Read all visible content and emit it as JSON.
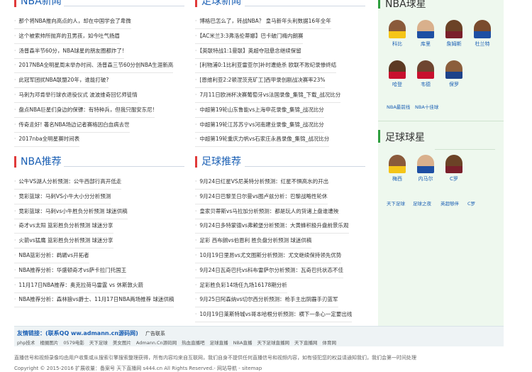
{
  "sections": {
    "nba_news": {
      "title": "NBA新闻",
      "items": [
        "那个将NBA推向高点的人，却在中国学会了卑微",
        "这个被索帅所抛弃的丑男孩，如今吐气扬眉",
        "汤普森半节60分，NBA球星的朋友圈都炸了!",
        "2017NBA全明星周末举办时间、汤普森三节60分创NBA生涯新高",
        "此冠军团扰NBA联盟20年，谁能打破?",
        "马刺为邓肯举行球衣退役仪式 波波维奇回忆师徒情",
        "盘点NBA巨星们身边的保镖：有特种兵，但我只服安东尼!",
        "传奇走好! 著名NBA场边记者赛格因白血病去世",
        "2017nba全明星赛时间表"
      ]
    },
    "football_news": {
      "title": "足球新闻",
      "items": [
        "博格巴怎么了，转战NBA？ 皇马新年头利数据16年全年",
        "【AC米兰3:3弗洛伦蒂娜】巴卡破门梅内朗赛",
        "【英联特战1:1曼联】英超夺冠悬念继续保留",
        "[利物浦0:1比利亚雷亚尔]补时遭绝杀 欧联不败纪录惨终结",
        "[恩维利亚2:2顿涅茨克矿工]西甲录创剧战决赛率23%",
        "7月11日欧洲杯决赛葡萄牙vs法国录像_集锦_下载_战况比分",
        "中超第19轮山东鲁能vs上海申花录像_集锦_战况比分",
        "中超第19轮江苏苏宁vs河南建业录像_集锦_战况比分",
        "中超第19轮重庆力帆vs石家庄永昌录像_集锦_战况比分"
      ]
    },
    "nba_recommend": {
      "title": "NBA推荐",
      "items": [
        "公牛VS湖人分析预测：公牛西部行高开低走",
        "竞彩篮球：马刺VS小牛大小分分析预测",
        "竞彩篮球：马刺vs小牛胜负分析预测 球迷供稿",
        "奇才vs太阳 篮彩胜负分析预测 球迷分享",
        "火箭vs猛鹰 篮彩胜负分析预测 球迷分享",
        "NBA篮彩分析：鹈鹕vs开拓者",
        "NBA推荐分析：华盛顿奇才vs萨卡拉门托国王",
        "11月17日NBA推荐：奥克拉荷马雷霆 vs 休斯敦火箭",
        "NBA推荐分析：森林狼vs爵士、11月17日NBA两场推荐 球迷供稿"
      ]
    },
    "football_recommend": {
      "title": "足球推荐",
      "items": [
        "9月24日红星VS尼美特分析预测：红星不惧高水的开出",
        "9月24日巴黎圣日尔曼vs图卢兹分析：巴黎战略性轮休",
        "皇家贝蒂斯vs马拉加分析预测：都是玩人的货诸上盘谁遭殃",
        "9月24日多特蒙德vs弗赖堡分析预测：大黄蜂积极升盘前景乐观",
        "足彩 西布朗vs伯恩利 胜负盘分析预测 球迷供稿",
        "10月19日里昂vs尤文图斯分析预测：尤文继续保持领先优势",
        "9月24日瓦奇巴托vs科布雷萨尔分析预测：瓦奇巴托状态不佳",
        "足彩胜负彩14场任九场16178期分析",
        "9月25日阿森纳vs切尔西分析预测：枪手主出阴霾手刃蓝军",
        "10月19日莱斯特城vs哥本哈根分析预测：横下一条心一定要出线"
      ]
    }
  },
  "sidebar": {
    "nba_stars": {
      "title": "NBA球星",
      "players": [
        "科比",
        "库里",
        "詹姆斯",
        "杜兰特",
        "哈登",
        "韦德",
        "保罗"
      ],
      "links": [
        "NBA最前线",
        "NBA十佳球"
      ]
    },
    "football_stars": {
      "title": "足球球星",
      "players": [
        "梅西",
        "内马尔",
        "C罗"
      ],
      "links": [
        "天下足球",
        "足球之夜",
        "英超够伴",
        "C罗"
      ]
    }
  },
  "friend_links": {
    "title": "友情链接：(联系QQ ww.admann.cn源码网)",
    "ad": "广告联系",
    "links": [
      "php技术",
      "楼圈图片",
      "0579电影",
      "天下足球",
      "美女图片",
      "Admann.Cn源码网",
      "热血直播吧",
      "足球直播",
      "NBA直播",
      "天下足球直播网",
      "天下直播网",
      "体育网"
    ]
  },
  "footer": {
    "disclaimer": "直播信号和视频录像均由用户收集或从搜索引擎搜索整理获得，所有内容均来自互联网，我们自身不提供任何直播信号和视频内容，如有侵犯您的权益请通知我们，我们会第一时间处理",
    "copyright": "Copyright © 2015-2016 扩展收量：备案号 天下直播网 s444.cn  All Rights Reserved.-  网站导航  -  sitemap"
  },
  "colors": {
    "title_blue": "#1a5fb4",
    "accent_red": "#e03a3a",
    "sidebar_bg": "#eef8ee",
    "sidebar_accent": "#2e9e3e"
  }
}
